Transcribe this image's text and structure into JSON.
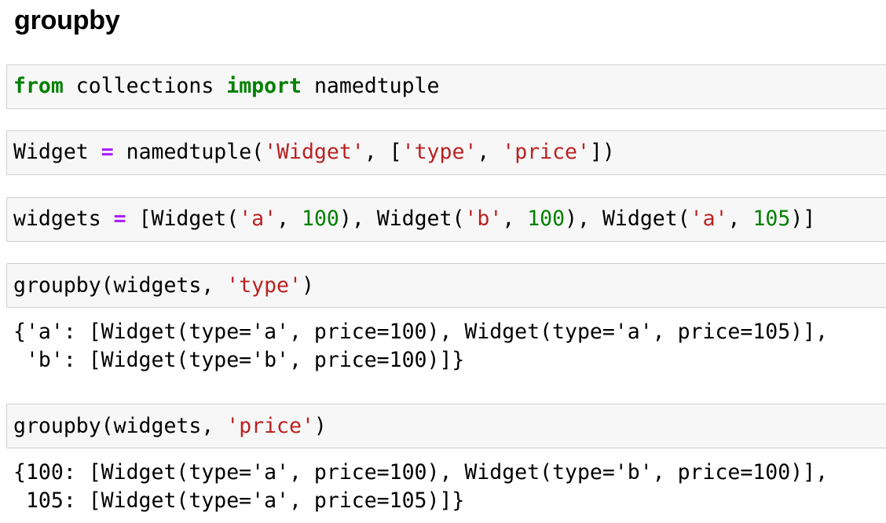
{
  "heading": "groupby",
  "cells": [
    {
      "input": [
        {
          "t": "kw",
          "v": "from"
        },
        {
          "t": "plain",
          "v": " collections "
        },
        {
          "t": "kw",
          "v": "import"
        },
        {
          "t": "plain",
          "v": " namedtuple"
        }
      ]
    },
    {
      "input": [
        {
          "t": "plain",
          "v": "Widget "
        },
        {
          "t": "op",
          "v": "="
        },
        {
          "t": "plain",
          "v": " namedtuple("
        },
        {
          "t": "str",
          "v": "'Widget'"
        },
        {
          "t": "plain",
          "v": ", ["
        },
        {
          "t": "str",
          "v": "'type'"
        },
        {
          "t": "plain",
          "v": ", "
        },
        {
          "t": "str",
          "v": "'price'"
        },
        {
          "t": "plain",
          "v": "])"
        }
      ]
    },
    {
      "input": [
        {
          "t": "plain",
          "v": "widgets "
        },
        {
          "t": "op",
          "v": "="
        },
        {
          "t": "plain",
          "v": " [Widget("
        },
        {
          "t": "str",
          "v": "'a'"
        },
        {
          "t": "plain",
          "v": ", "
        },
        {
          "t": "num",
          "v": "100"
        },
        {
          "t": "plain",
          "v": "), Widget("
        },
        {
          "t": "str",
          "v": "'b'"
        },
        {
          "t": "plain",
          "v": ", "
        },
        {
          "t": "num",
          "v": "100"
        },
        {
          "t": "plain",
          "v": "), Widget("
        },
        {
          "t": "str",
          "v": "'a'"
        },
        {
          "t": "plain",
          "v": ", "
        },
        {
          "t": "num",
          "v": "105"
        },
        {
          "t": "plain",
          "v": ")]"
        }
      ]
    },
    {
      "input": [
        {
          "t": "plain",
          "v": "groupby(widgets, "
        },
        {
          "t": "str",
          "v": "'type'"
        },
        {
          "t": "plain",
          "v": ")"
        }
      ],
      "output": [
        "{'a': [Widget(type='a', price=100), Widget(type='a', price=105)],",
        " 'b': [Widget(type='b', price=100)]}"
      ]
    },
    {
      "input": [
        {
          "t": "plain",
          "v": "groupby(widgets, "
        },
        {
          "t": "str",
          "v": "'price'"
        },
        {
          "t": "plain",
          "v": ")"
        }
      ],
      "output": [
        "{100: [Widget(type='a', price=100), Widget(type='b', price=100)],",
        " 105: [Widget(type='a', price=105)]}"
      ]
    }
  ],
  "colors": {
    "keyword": "#008000",
    "operator": "#aa22ff",
    "string": "#ba2121",
    "number": "#008000",
    "cell_background": "#f7f7f7",
    "cell_border": "#cfcfcf"
  }
}
